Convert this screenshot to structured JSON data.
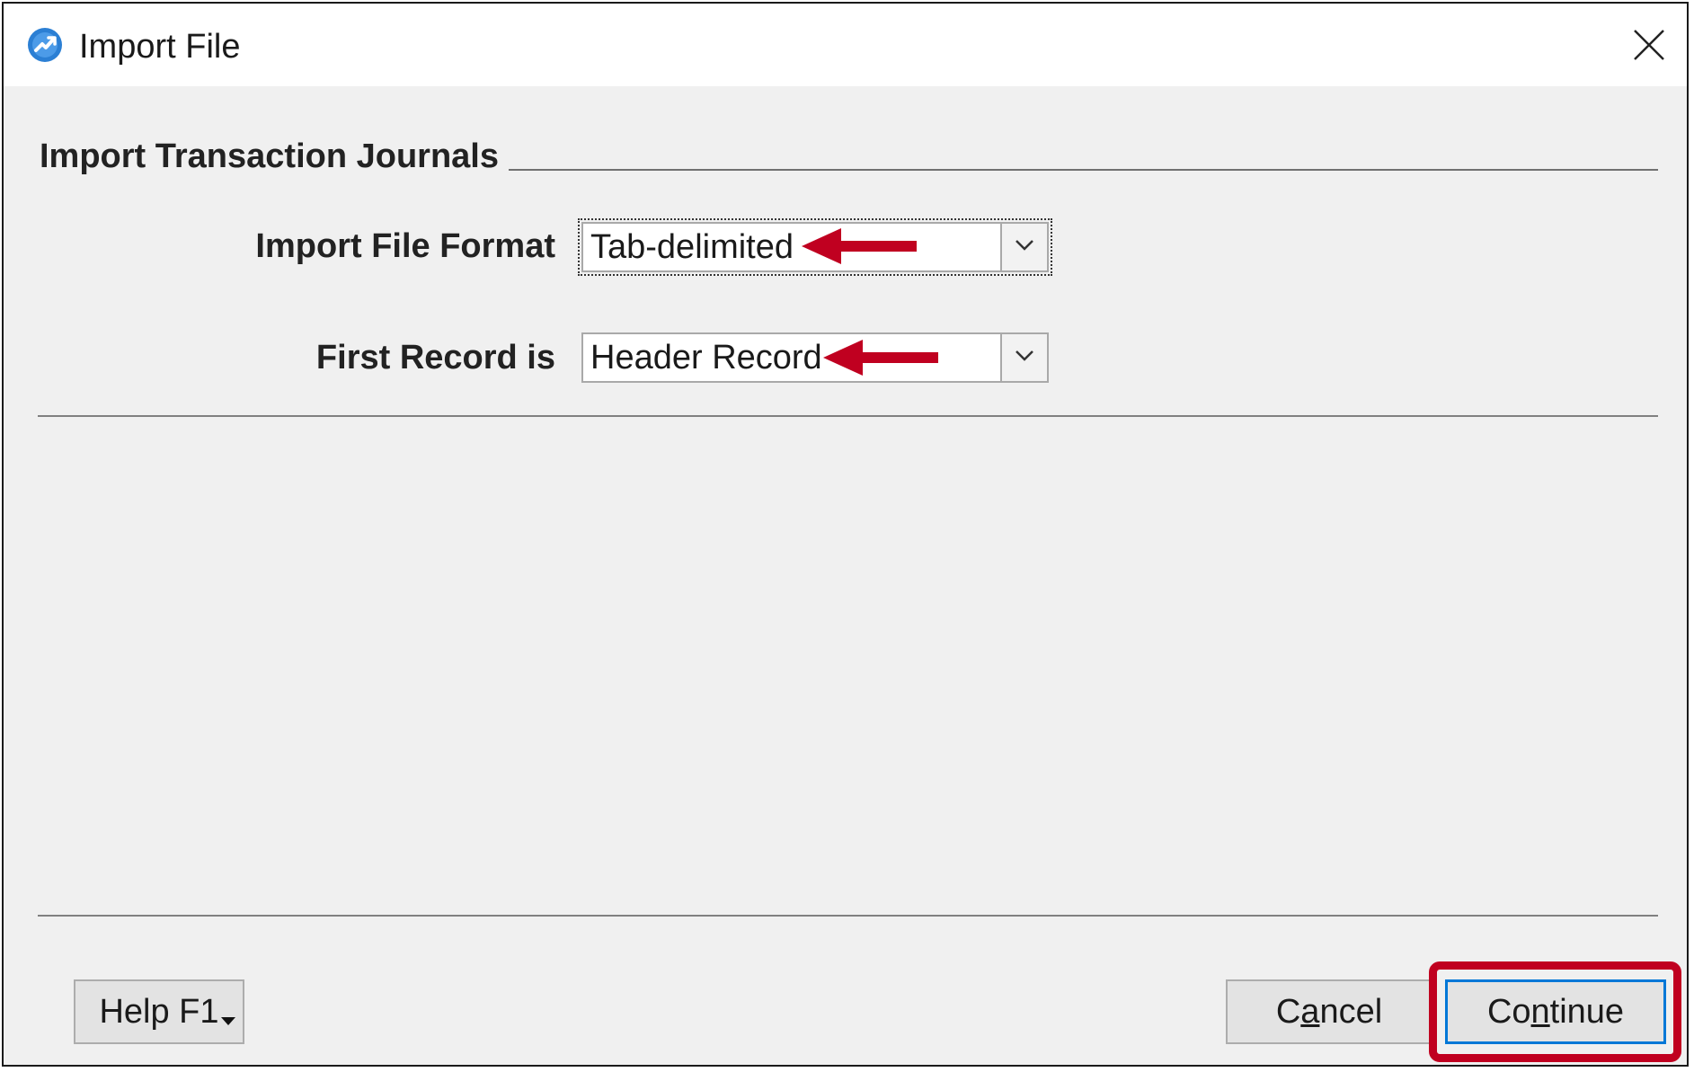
{
  "window": {
    "title": "Import File",
    "icon": "app-logo-icon",
    "close_icon": "close-icon"
  },
  "section": {
    "title": "Import Transaction Journals"
  },
  "fields": {
    "format": {
      "label": "Import File Format",
      "value": "Tab-delimited"
    },
    "first_record": {
      "label": "First Record is",
      "value": "Header Record"
    }
  },
  "buttons": {
    "help": "Help F1",
    "cancel_pre": "C",
    "cancel_mnemonic": "a",
    "cancel_post": "ncel",
    "continue_pre": "Co",
    "continue_mnemonic": "n",
    "continue_post": "tinue"
  },
  "annotations": {
    "arrow_color": "#c00020",
    "highlight_color": "#c00020"
  },
  "colors": {
    "dialog_bg": "#f0f0f0",
    "titlebar_bg": "#ffffff",
    "focus_blue": "#0078d7",
    "app_icon_blue": "#2b7fd4"
  }
}
